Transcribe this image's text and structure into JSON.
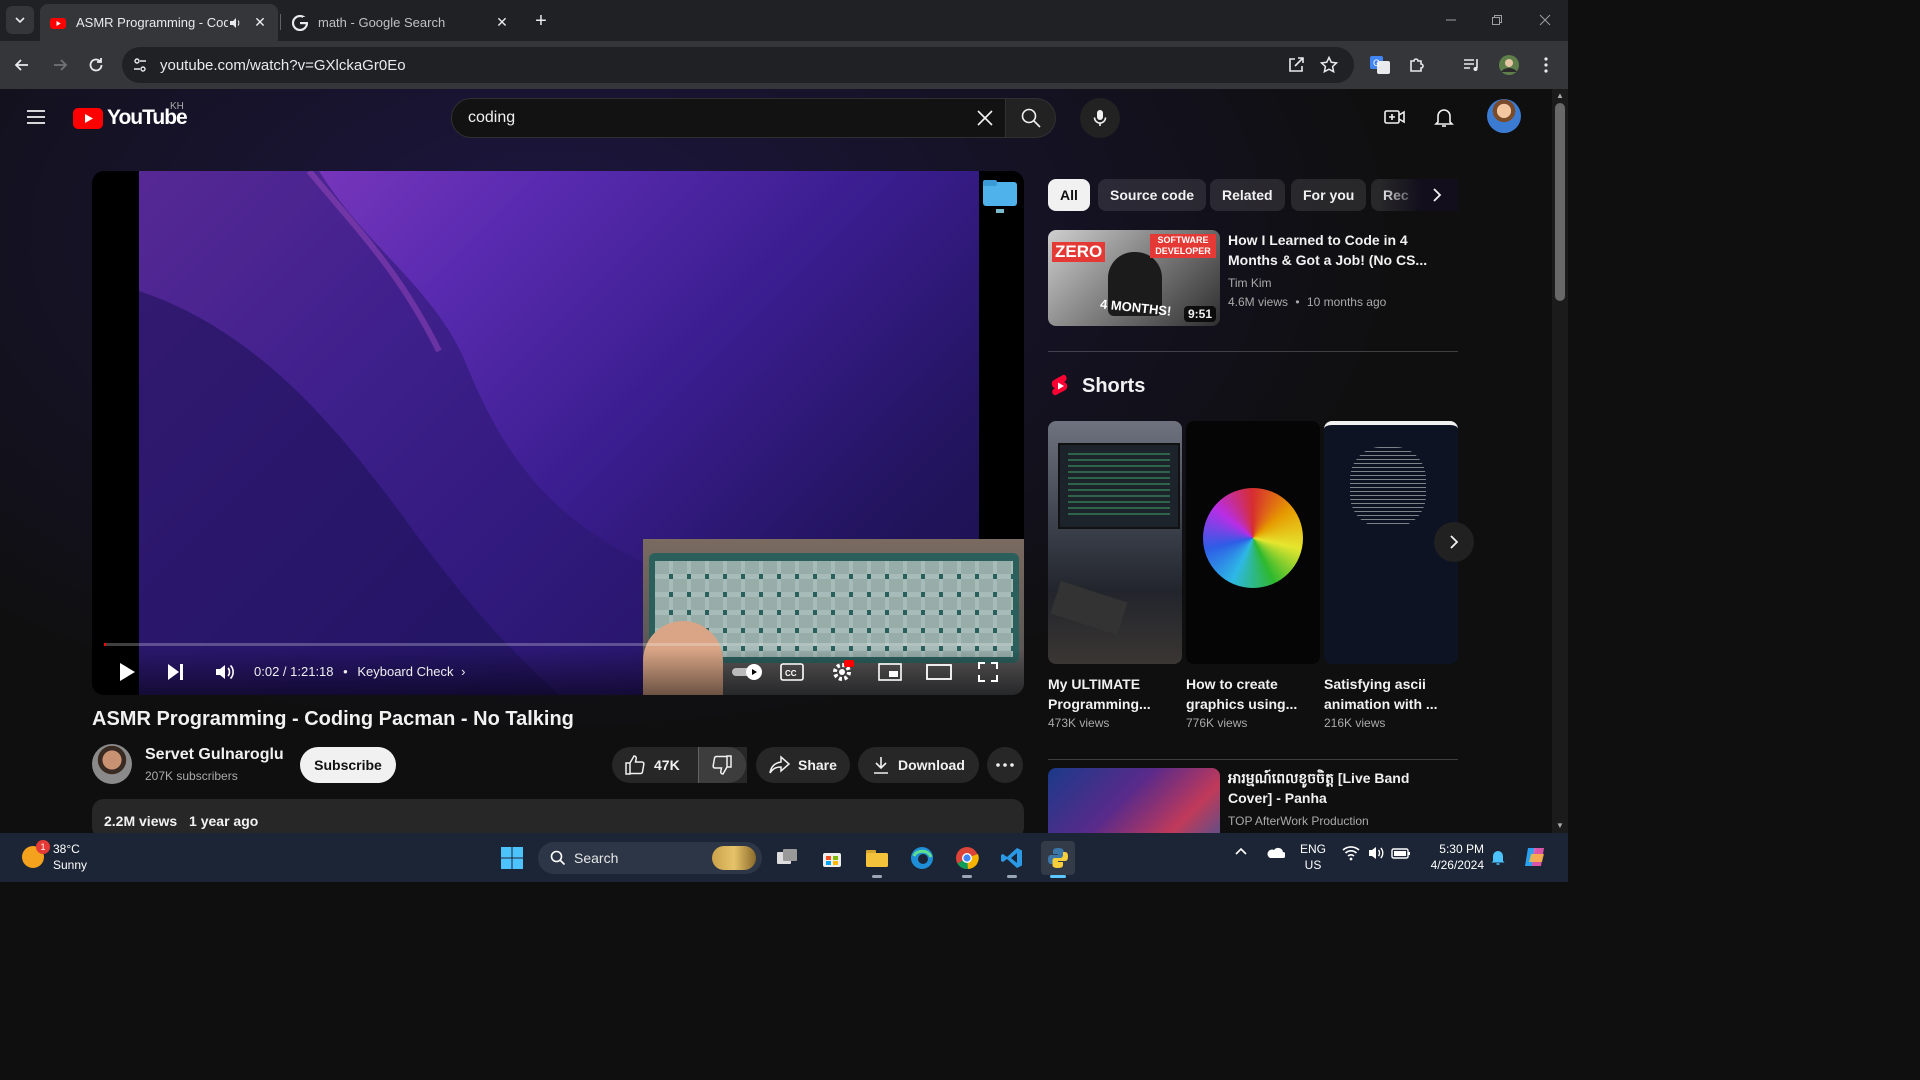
{
  "browser": {
    "tabs": [
      {
        "title": "ASMR Programming - Codi",
        "active": true
      },
      {
        "title": "math - Google Search",
        "active": false
      }
    ],
    "url": "youtube.com/watch?v=GXlckaGr0Eo"
  },
  "youtube": {
    "region": "KH",
    "logo_text": "YouTube",
    "search_query": "coding",
    "player": {
      "time": "0:02 / 1:21:18",
      "chapter": "Keyboard Check",
      "progress_fraction": 0.0004
    },
    "video": {
      "title": "ASMR Programming - Coding Pacman - No Talking",
      "channel": "Servet Gulnaroglu",
      "subscribers": "207K subscribers",
      "subscribe_label": "Subscribe",
      "likes": "47K",
      "share_label": "Share",
      "download_label": "Download",
      "views": "2.2M views",
      "age": "1 year ago"
    },
    "chips": [
      "All",
      "Source code",
      "Related",
      "For you",
      "Rec"
    ],
    "recommendations": [
      {
        "title": "How I Learned to Code in 4 Months & Got a Job! (No CS...",
        "channel": "Tim Kim",
        "views": "4.6M views",
        "age": "10 months ago",
        "duration": "9:51",
        "thumb_text_left": "ZERO",
        "thumb_text_right": "SOFTWARE DEVELOPER",
        "thumb_text_bottom": "4 MONTHS!"
      },
      {
        "title": "អារម្មណ៍ពេលខូចចិត្ត [Live Band Cover] - Panha",
        "channel": "TOP AfterWork Production"
      }
    ],
    "shorts": {
      "heading": "Shorts",
      "items": [
        {
          "title": "My ULTIMATE Programming...",
          "views": "473K views"
        },
        {
          "title": "How to create graphics using...",
          "views": "776K views"
        },
        {
          "title": "Satisfying ascii animation with ...",
          "views": "216K views"
        }
      ]
    }
  },
  "taskbar": {
    "weather_temp": "38°C",
    "weather_desc": "Sunny",
    "weather_badge": "1",
    "search_placeholder": "Search",
    "lang_top": "ENG",
    "lang_bottom": "US",
    "time": "5:30 PM",
    "date": "4/26/2024"
  }
}
